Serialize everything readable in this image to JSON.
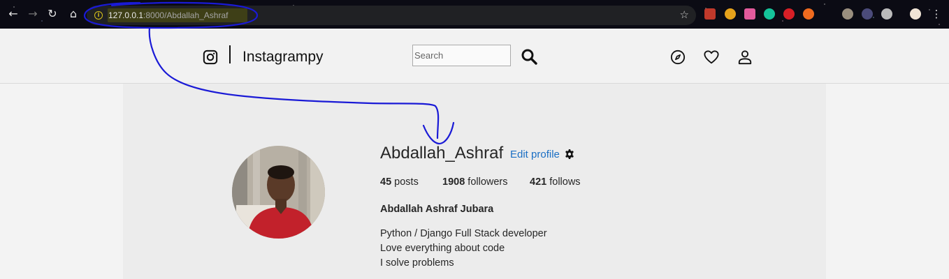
{
  "browser": {
    "url_host": "127.0.0.1",
    "url_path": ":8000/Abdallah_Ashraf",
    "back_icon": "←",
    "forward_icon": "→",
    "reload_icon": "↻",
    "home_icon": "⌂",
    "info_icon": "i",
    "star_icon": "☆"
  },
  "header": {
    "brand": "Instagrampy",
    "search_placeholder": "Search"
  },
  "profile": {
    "username": "Abdallah_Ashraf",
    "edit_label": "Edit profile",
    "stats": [
      {
        "count": "45",
        "label": "posts"
      },
      {
        "count": "1908",
        "label": "followers"
      },
      {
        "count": "421",
        "label": "follows"
      }
    ],
    "full_name": "Abdallah Ashraf Jubara",
    "bio": [
      "Python / Django Full Stack developer",
      "Love everything about code",
      "I solve problems"
    ]
  },
  "colors": {
    "link": "#1b6fc4",
    "annotation": "#1a1ad6",
    "url_highlight": "#d8c21a"
  }
}
